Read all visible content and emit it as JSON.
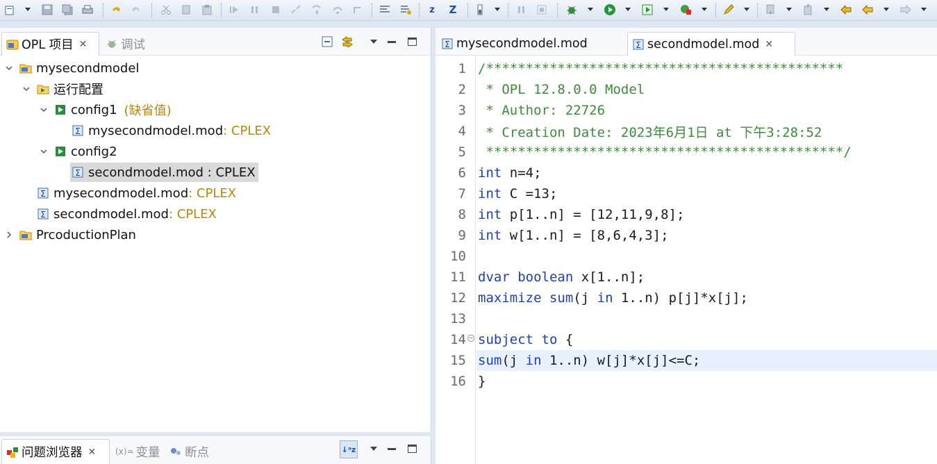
{
  "left_panel": {
    "tabs": [
      {
        "label": "OPL 项目",
        "icon": "opl-projects-icon",
        "closable": true
      },
      {
        "label": "调试",
        "icon": "debug-icon",
        "closable": false
      }
    ],
    "tree": [
      {
        "label": "mysecondmodel",
        "suffix": "",
        "icon": "project-folder-icon",
        "expanded": true,
        "level": 0
      },
      {
        "label": "运行配置",
        "suffix": "",
        "icon": "run-config-folder-icon",
        "expanded": true,
        "level": 1
      },
      {
        "label": "config1",
        "suffix": "(缺省值)",
        "icon": "config-icon",
        "expanded": true,
        "level": 2
      },
      {
        "label": "mysecondmodel.mod",
        "suffix": " : CPLEX",
        "icon": "model-file-icon",
        "level": 3
      },
      {
        "label": "config2",
        "suffix": "",
        "icon": "config-icon",
        "expanded": true,
        "level": 2
      },
      {
        "label": "secondmodel.mod : CPLEX",
        "suffix": "",
        "icon": "model-file-icon",
        "level": 3,
        "selected": true
      },
      {
        "label": "mysecondmodel.mod",
        "suffix": " : CPLEX",
        "icon": "model-file-icon",
        "level": 1
      },
      {
        "label": "secondmodel.mod",
        "suffix": " : CPLEX",
        "icon": "model-file-icon",
        "level": 1
      },
      {
        "label": "PrcoductionPlan",
        "suffix": "",
        "icon": "project-folder-icon",
        "expanded": false,
        "level": 0
      }
    ]
  },
  "bottom_panel": {
    "tabs": [
      {
        "label": "问题浏览器",
        "icon": "problem-browser-icon",
        "closable": true
      },
      {
        "label": "变量",
        "icon": "variables-icon",
        "prefix": "(x)="
      },
      {
        "label": "断点",
        "icon": "breakpoints-icon"
      }
    ]
  },
  "editor": {
    "tabs": [
      {
        "label": "mysecondmodel.mod",
        "active": false
      },
      {
        "label": "secondmodel.mod",
        "active": true,
        "closable": true
      }
    ],
    "current_line": 15,
    "lines": [
      {
        "n": "1",
        "parts": [
          [
            "cm",
            "/*********************************************"
          ]
        ]
      },
      {
        "n": "2",
        "parts": [
          [
            "cm",
            " * OPL 12.8.0.0 Model"
          ]
        ]
      },
      {
        "n": "3",
        "parts": [
          [
            "cm",
            " * Author: 22726"
          ]
        ]
      },
      {
        "n": "4",
        "parts": [
          [
            "cm",
            " * Creation Date: 2023年6月1日 at 下午3:28:52"
          ]
        ]
      },
      {
        "n": "5",
        "parts": [
          [
            "cm",
            " *********************************************/"
          ]
        ]
      },
      {
        "n": "6",
        "parts": [
          [
            "kw",
            "int"
          ],
          [
            "tx",
            " n=4;"
          ]
        ]
      },
      {
        "n": "7",
        "parts": [
          [
            "kw",
            "int"
          ],
          [
            "tx",
            " C =13;"
          ]
        ]
      },
      {
        "n": "8",
        "parts": [
          [
            "kw",
            "int"
          ],
          [
            "tx",
            " p[1..n] = [12,11,9,8];"
          ]
        ]
      },
      {
        "n": "9",
        "parts": [
          [
            "kw",
            "int"
          ],
          [
            "tx",
            " w[1..n] = [8,6,4,3];"
          ]
        ]
      },
      {
        "n": "10",
        "parts": []
      },
      {
        "n": "11",
        "parts": [
          [
            "kw",
            "dvar"
          ],
          [
            "tx",
            " "
          ],
          [
            "kw",
            "boolean"
          ],
          [
            "tx",
            " x[1..n];"
          ]
        ]
      },
      {
        "n": "12",
        "parts": [
          [
            "kw",
            "maximize"
          ],
          [
            "tx",
            " "
          ],
          [
            "kw",
            "sum"
          ],
          [
            "tx",
            "(j "
          ],
          [
            "kw",
            "in"
          ],
          [
            "tx",
            " 1..n) p[j]*x[j];"
          ]
        ]
      },
      {
        "n": "13",
        "parts": []
      },
      {
        "n": "14",
        "parts": [
          [
            "kw",
            "subject to"
          ],
          [
            "tx",
            " {"
          ]
        ],
        "fold": true
      },
      {
        "n": "15",
        "parts": [
          [
            "kw",
            "sum"
          ],
          [
            "tx",
            "(j "
          ],
          [
            "kw",
            "in"
          ],
          [
            "tx",
            " 1..n) w[j]*x[j]<=C;"
          ]
        ]
      },
      {
        "n": "16",
        "parts": [
          [
            "tx",
            "}"
          ]
        ]
      }
    ]
  }
}
